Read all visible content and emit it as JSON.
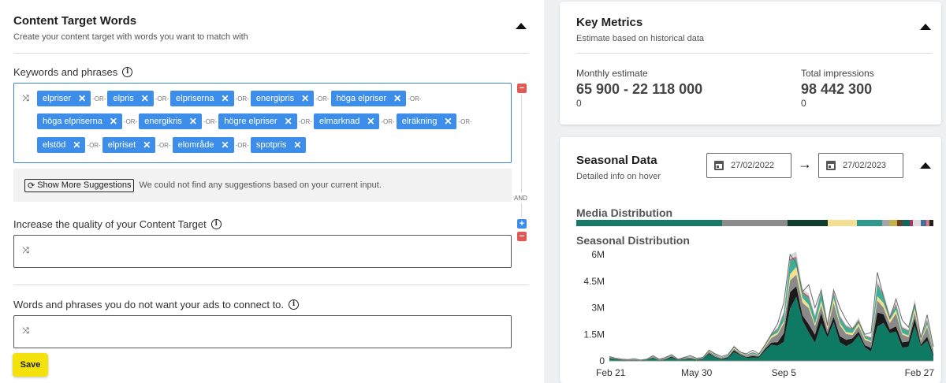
{
  "content_target": {
    "title": "Content Target Words",
    "subtitle": "Create your content target with words you want to match with",
    "keywords_label": "Keywords and phrases",
    "shuffle_glyph": "⤨",
    "or_text": "-OR-",
    "remove_glyph": "✕",
    "keywords": [
      [
        "elpriser",
        "elpris",
        "elpriserna",
        "energipris",
        "höga elpriser"
      ],
      [
        "höga elpriserna",
        "energikris",
        "högre elpriser",
        "elmarknad",
        "elräkning"
      ],
      [
        "elstöd",
        "elpriset",
        "elområde",
        "spotpris"
      ]
    ],
    "and_text": "AND",
    "suggestions_button": "Show More Suggestions",
    "suggestions_message": "We could not find any suggestions based on your current input.",
    "quality_label": "Increase the quality of your Content Target",
    "negative_label": "Words and phrases you do not want your ads to connect to.",
    "save_label": "Save"
  },
  "key_metrics": {
    "title": "Key Metrics",
    "subtitle": "Estimate based on historical data",
    "monthly_label": "Monthly estimate",
    "monthly_value": "65 900 - 22 118 000",
    "monthly_sub": "0",
    "impressions_label": "Total impressions",
    "impressions_value": "98 442 300",
    "impressions_sub": "0"
  },
  "seasonal": {
    "title": "Seasonal Data",
    "subtitle": "Detailed info on hover",
    "date_from": "27/02/2022",
    "date_to": "27/02/2023",
    "arrow_glyph": "→",
    "media_title": "Media Distribution",
    "seasonal_title": "Seasonal Distribution",
    "media_colors": [
      "#167a66",
      "#8c8c8c",
      "#0f3d2e",
      "#f3df8f",
      "#2e9a8e",
      "#a5a5a5",
      "#c4b24a",
      "#6d3b2a",
      "#0b6b5a",
      "#b0346a",
      "#ddd",
      "#4a6e9b",
      "#e07a7a",
      "#222"
    ],
    "media_shares": [
      0.4,
      0.18,
      0.11,
      0.08,
      0.07,
      0.02,
      0.02,
      0.015,
      0.02,
      0.01,
      0.02,
      0.015,
      0.01,
      0.01
    ],
    "palette": {
      "base": "#0f7a64",
      "black": "#1a1a1a",
      "gray": "#8a8a8a",
      "yellow": "#f3df8f",
      "teal": "#3fae94",
      "pink": "#c9507a",
      "light": "#cfd8d3"
    }
  },
  "chart_data": {
    "type": "area",
    "stacked": true,
    "y_ticks": [
      "6M",
      "4.5M",
      "3M",
      "1.5M",
      "0"
    ],
    "ylim": [
      0,
      6000000
    ],
    "x_ticks": [
      {
        "label": "Feb 21",
        "week": 0
      },
      {
        "label": "May 30",
        "week": 14
      },
      {
        "label": "Sep 5",
        "week": 28
      },
      {
        "label": "Feb 27",
        "week": 53
      }
    ],
    "weeks": 53,
    "series_colors": [
      "base",
      "black",
      "gray",
      "yellow",
      "teal",
      "pink",
      "light"
    ],
    "total": [
      0.25,
      0.15,
      0.1,
      0.08,
      0.12,
      0.05,
      0.1,
      0.3,
      0.1,
      0.2,
      0.35,
      0.1,
      0.2,
      0.3,
      0.15,
      0.2,
      0.6,
      0.4,
      0.25,
      0.35,
      0.8,
      0.5,
      0.4,
      0.6,
      0.4,
      0.9,
      1.5,
      2.1,
      3.3,
      6.0,
      5.5,
      3.9,
      4.3,
      3.0,
      4.0,
      2.0,
      4.0,
      3.0,
      2.3,
      1.8,
      2.2,
      1.5,
      1.6,
      5.0,
      3.6,
      2.4,
      3.5,
      2.3,
      1.9,
      3.2,
      1.3,
      2.6,
      0.8
    ],
    "shares": [
      0.5,
      0.12,
      0.16,
      0.06,
      0.1,
      0.02,
      0.04
    ]
  }
}
